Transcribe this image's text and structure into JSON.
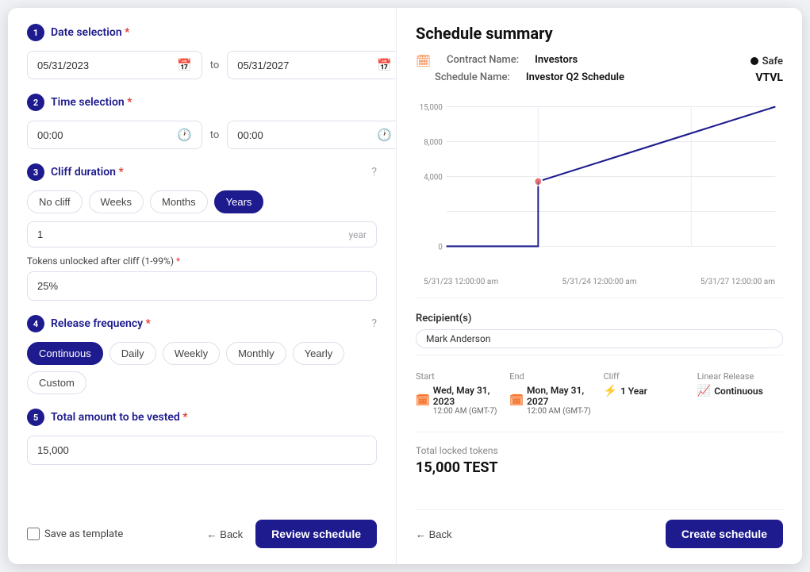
{
  "left": {
    "sections": {
      "date": {
        "number": "1",
        "title": "Date selection",
        "start": "05/31/2023",
        "end": "05/31/2027",
        "to": "to"
      },
      "time": {
        "number": "2",
        "title": "Time selection",
        "start": "00:00",
        "end": "00:00",
        "to": "to"
      },
      "cliff": {
        "number": "3",
        "title": "Cliff duration",
        "pills": [
          "No cliff",
          "Weeks",
          "Months",
          "Years"
        ],
        "active": "Years",
        "value": "1",
        "unit": "year",
        "sub_label": "Tokens unlocked after cliff (1-99%) *",
        "cliff_value": "25%"
      },
      "frequency": {
        "number": "4",
        "title": "Release frequency",
        "pills": [
          "Continuous",
          "Daily",
          "Weekly",
          "Monthly",
          "Yearly",
          "Custom"
        ],
        "active": "Continuous"
      },
      "amount": {
        "number": "5",
        "title": "Total amount to be vested",
        "value": "15,000"
      }
    },
    "save_template": "Save as template",
    "back_label": "← Back",
    "review_label": "Review schedule"
  },
  "right": {
    "title": "Schedule summary",
    "contract_label": "Contract Name:",
    "contract_value": "Investors",
    "safe_label": "Safe",
    "schedule_label": "Schedule Name:",
    "schedule_value": "Investor Q2 Schedule",
    "vtvl_label": "VTVL",
    "chart": {
      "y_labels": [
        "15,000",
        "8,000",
        "4,000",
        "0"
      ],
      "x_labels": [
        "5/31/23 12:00:00 am",
        "5/31/24 12:00:00 am",
        "5/31/27 12:00:00 am"
      ]
    },
    "recipients_label": "Recipient(s)",
    "recipient": "Mark Anderson",
    "info": {
      "start_label": "Start",
      "start_value": "Wed, May 31, 2023",
      "start_sub": "12:00 AM (GMT-7)",
      "end_label": "End",
      "end_value": "Mon, May 31, 2027",
      "end_sub": "12:00 AM (GMT-7)",
      "cliff_label": "Cliff",
      "cliff_value": "1 Year",
      "linear_label": "Linear Release",
      "linear_value": "Continuous"
    },
    "total_label": "Total locked tokens",
    "total_value": "15,000 TEST",
    "back_label": "← Back",
    "create_label": "Create schedule"
  }
}
